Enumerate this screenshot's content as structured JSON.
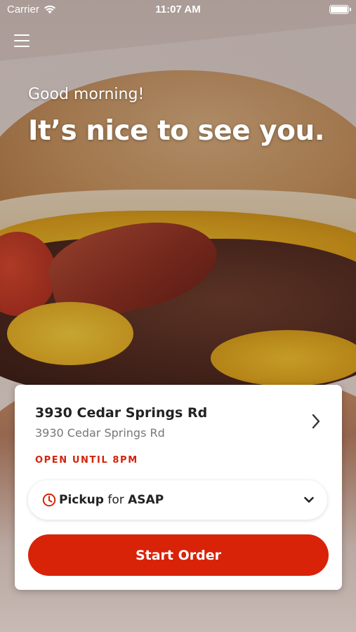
{
  "status_bar": {
    "carrier": "Carrier",
    "time": "11:07 AM"
  },
  "greeting": {
    "subtitle": "Good morning!",
    "title": "It’s nice to see you."
  },
  "store": {
    "name": "3930 Cedar Springs Rd",
    "address": "3930 Cedar Springs Rd",
    "hours": "OPEN UNTIL 8PM"
  },
  "order_mode": {
    "mode": "Pickup",
    "for": "for",
    "time": "ASAP"
  },
  "actions": {
    "start_order": "Start Order"
  },
  "colors": {
    "accent": "#d82309",
    "hours_text": "#d3230c"
  },
  "icons": {
    "menu": "hamburger-menu-icon",
    "wifi": "wifi-icon",
    "battery": "battery-icon",
    "store_chevron": "chevron-right-icon",
    "clock": "clock-icon",
    "dropdown": "chevron-down-icon"
  }
}
